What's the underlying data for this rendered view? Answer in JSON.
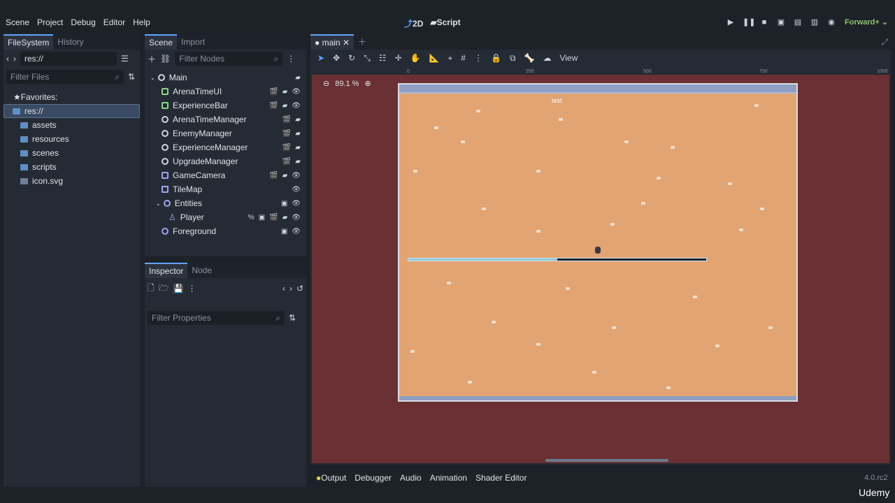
{
  "menu": [
    "Scene",
    "Project",
    "Debug",
    "Editor",
    "Help"
  ],
  "modes": {
    "two_d": "2D",
    "script": "Script"
  },
  "renderer": "Forward+",
  "filesystem": {
    "tabs": [
      "FileSystem",
      "History"
    ],
    "path": "res://",
    "filter_placeholder": "Filter Files",
    "favorites": "Favorites:",
    "root": "res://",
    "items": [
      "assets",
      "resources",
      "scenes",
      "scripts",
      "icon.svg"
    ]
  },
  "scene": {
    "tabs": [
      "Scene",
      "Import"
    ],
    "filter_placeholder": "Filter Nodes",
    "nodes": [
      "Main",
      "ArenaTimeUI",
      "ExperienceBar",
      "ArenaTimeManager",
      "EnemyManager",
      "ExperienceManager",
      "UpgradeManager",
      "GameCamera",
      "TileMap",
      "Entities",
      "Player",
      "Foreground"
    ]
  },
  "inspector": {
    "tabs": [
      "Inspector",
      "Node"
    ],
    "filter_placeholder": "Filter Properties"
  },
  "viewport": {
    "tab": "main",
    "view_label": "View",
    "zoom": "89.1 %",
    "ruler": [
      "0",
      "250",
      "500",
      "750",
      "1000"
    ],
    "label": "test",
    "experience_fill": 0.5
  },
  "bottom": [
    "Output",
    "Debugger",
    "Audio",
    "Animation",
    "Shader Editor"
  ],
  "version": "4.0.rc2",
  "watermark": "Udemy"
}
